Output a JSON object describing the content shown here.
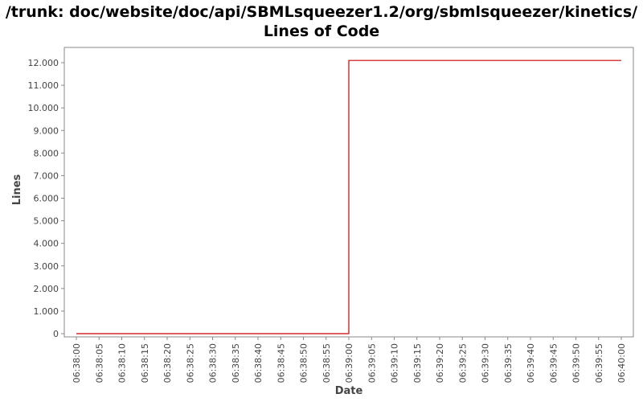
{
  "chart_data": {
    "type": "line",
    "title": "/trunk: doc/website/doc/api/SBMLsqueezer1.2/org/sbmlsqueezer/kinetics/",
    "subtitle": "Lines of Code",
    "xlabel": "Date",
    "ylabel": "Lines",
    "step": true,
    "grid": false,
    "ylim": [
      0,
      12500
    ],
    "yticks": [
      "0",
      "1.000",
      "2.000",
      "3.000",
      "4.000",
      "5.000",
      "6.000",
      "7.000",
      "8.000",
      "9.000",
      "10.000",
      "11.000",
      "12.000"
    ],
    "ytick_values": [
      0,
      1000,
      2000,
      3000,
      4000,
      5000,
      6000,
      7000,
      8000,
      9000,
      10000,
      11000,
      12000
    ],
    "xlim": [
      "06:38:00",
      "06:40:00"
    ],
    "xticks": [
      "06:38:00",
      "06:38:05",
      "06:38:10",
      "06:38:15",
      "06:38:20",
      "06:38:25",
      "06:38:30",
      "06:38:35",
      "06:38:40",
      "06:38:45",
      "06:38:50",
      "06:38:55",
      "06:39:00",
      "06:39:05",
      "06:39:10",
      "06:39:15",
      "06:39:20",
      "06:39:25",
      "06:39:30",
      "06:39:35",
      "06:39:40",
      "06:39:45",
      "06:39:50",
      "06:39:55",
      "06:40:00"
    ],
    "series": [
      {
        "color": "#cc0000",
        "points": [
          {
            "x": "06:38:00",
            "y": 0
          },
          {
            "x": "06:39:00",
            "y": 0
          },
          {
            "x": "06:39:00",
            "y": 12100
          },
          {
            "x": "06:40:00",
            "y": 12100
          }
        ]
      }
    ]
  }
}
